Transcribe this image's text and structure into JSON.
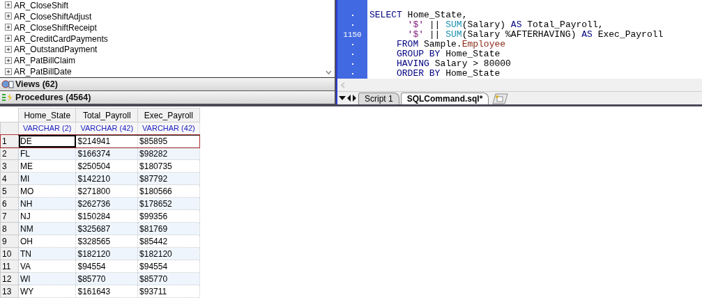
{
  "tree": {
    "items": [
      {
        "label": "AR_CloseShift",
        "expanded": false
      },
      {
        "label": "AR_CloseShiftAdjust",
        "expanded": false
      },
      {
        "label": "AR_CloseShiftReceipt",
        "expanded": false
      },
      {
        "label": "AR_CreditCardPayments",
        "expanded": false
      },
      {
        "label": "AR_OutstandPayment",
        "expanded": false
      },
      {
        "label": "AR_PatBillClaim",
        "expanded": false
      },
      {
        "label": "AR_PatBillDate",
        "expanded": false
      }
    ]
  },
  "sections": [
    {
      "label": "Views (62)",
      "kind": "views"
    },
    {
      "label": "Procedures (4564)",
      "kind": "procedures"
    }
  ],
  "editor": {
    "lines": [
      {
        "tokens": [
          {
            "text": "SELECT",
            "kind": "keyword"
          },
          {
            "text": " Home_State,",
            "kind": "plain"
          }
        ]
      },
      {
        "tokens": [
          {
            "text": "       '$'",
            "kind": "string"
          },
          {
            "text": " || ",
            "kind": "plain"
          },
          {
            "text": "SUM",
            "kind": "function"
          },
          {
            "text": "(Salary) ",
            "kind": "plain"
          },
          {
            "text": "AS",
            "kind": "keyword"
          },
          {
            "text": " Total_Payroll,",
            "kind": "plain"
          }
        ]
      },
      {
        "number": "1150",
        "tokens": [
          {
            "text": "       '$'",
            "kind": "string"
          },
          {
            "text": " || ",
            "kind": "plain"
          },
          {
            "text": "SUM",
            "kind": "function"
          },
          {
            "text": "(Salary %AFTERHAVING) ",
            "kind": "plain"
          },
          {
            "text": "AS",
            "kind": "keyword"
          },
          {
            "text": " Exec_Payroll",
            "kind": "plain"
          }
        ]
      },
      {
        "tokens": [
          {
            "text": "     FROM",
            "kind": "keyword"
          },
          {
            "text": " Sample.",
            "kind": "plain"
          },
          {
            "text": "Employee",
            "kind": "table"
          }
        ]
      },
      {
        "tokens": [
          {
            "text": "     GROUP BY",
            "kind": "keyword"
          },
          {
            "text": " Home_State",
            "kind": "plain"
          }
        ]
      },
      {
        "tokens": [
          {
            "text": "     HAVING",
            "kind": "keyword"
          },
          {
            "text": " Salary > 80000",
            "kind": "plain"
          }
        ]
      },
      {
        "tokens": [
          {
            "text": "     ORDER BY",
            "kind": "keyword"
          },
          {
            "text": " Home_State",
            "kind": "plain"
          }
        ]
      }
    ],
    "tabs": [
      {
        "label": "Script 1",
        "selected": false
      },
      {
        "label": "SQLCommand.sql*",
        "selected": true
      }
    ]
  },
  "results": {
    "columns": [
      {
        "name": "Home_State",
        "type": "VARCHAR (2)"
      },
      {
        "name": "Total_Payroll",
        "type": "VARCHAR (42)"
      },
      {
        "name": "Exec_Payroll",
        "type": "VARCHAR (42)"
      }
    ],
    "rows": [
      {
        "number": "1",
        "cells": [
          "DE",
          "$214941",
          "$85895"
        ],
        "selected": true
      },
      {
        "number": "2",
        "cells": [
          "FL",
          "$166374",
          "$98282"
        ],
        "selected": false
      },
      {
        "number": "3",
        "cells": [
          "ME",
          "$250504",
          "$180735"
        ],
        "selected": false
      },
      {
        "number": "4",
        "cells": [
          "MI",
          "$142210",
          "$87792"
        ],
        "selected": false
      },
      {
        "number": "5",
        "cells": [
          "MO",
          "$271800",
          "$180566"
        ],
        "selected": false
      },
      {
        "number": "6",
        "cells": [
          "NH",
          "$262736",
          "$178652"
        ],
        "selected": false
      },
      {
        "number": "7",
        "cells": [
          "NJ",
          "$150284",
          "$99356"
        ],
        "selected": false
      },
      {
        "number": "8",
        "cells": [
          "NM",
          "$325687",
          "$81769"
        ],
        "selected": false
      },
      {
        "number": "9",
        "cells": [
          "OH",
          "$328565",
          "$85442"
        ],
        "selected": false
      },
      {
        "number": "10",
        "cells": [
          "TN",
          "$182120",
          "$182120"
        ],
        "selected": false
      },
      {
        "number": "11",
        "cells": [
          "VA",
          "$94554",
          "$94554"
        ],
        "selected": false
      },
      {
        "number": "12",
        "cells": [
          "WI",
          "$85770",
          "$85770"
        ],
        "selected": false
      },
      {
        "number": "13",
        "cells": [
          "WY",
          "$161643",
          "$93711"
        ],
        "selected": false
      }
    ]
  }
}
